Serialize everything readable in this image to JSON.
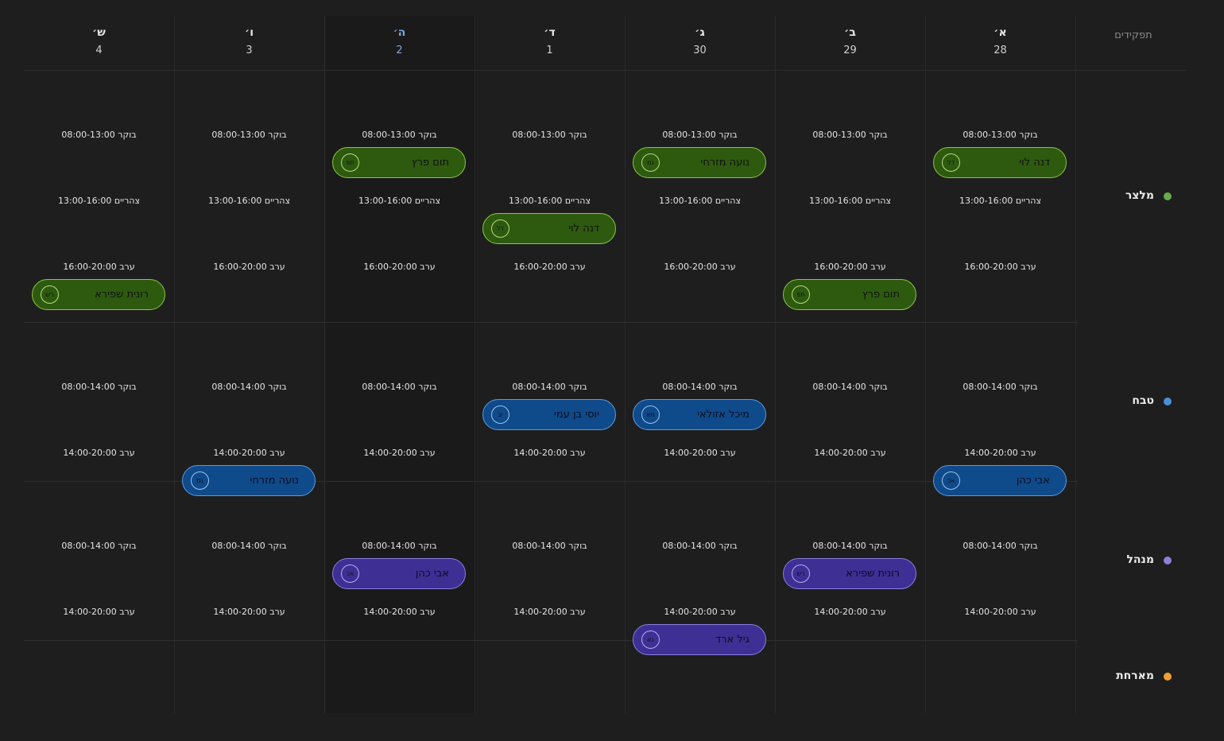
{
  "roles_title": "תפקידים",
  "colors": {
    "מלצר": "#6aa84f",
    "טבח": "#4a90d9",
    "מנהל": "#8a80d6",
    "מארחת": "#f0a030"
  },
  "days": [
    {
      "name": "א׳",
      "date": "28"
    },
    {
      "name": "ב׳",
      "date": "29"
    },
    {
      "name": "ג׳",
      "date": "30"
    },
    {
      "name": "ד׳",
      "date": "1"
    },
    {
      "name": "ה׳",
      "date": "2"
    },
    {
      "name": "ו׳",
      "date": "3"
    },
    {
      "name": "ש׳",
      "date": "4"
    }
  ],
  "roles": [
    {
      "name": "מלצר",
      "shifts": [
        "בוקר 08:00-13:00",
        "צהריים 13:00-16:00",
        "ערב 16:00-20:00"
      ]
    },
    {
      "name": "טבח",
      "shifts": [
        "בוקר 08:00-14:00",
        "ערב 14:00-20:00"
      ]
    },
    {
      "name": "מנהל",
      "shifts": [
        "בוקר 08:00-14:00",
        "ערב 14:00-20:00"
      ]
    },
    {
      "name": "מארחת",
      "shifts": []
    }
  ],
  "assignments": [
    {
      "role": "מלצר",
      "day": "א׳",
      "shift": "בוקר 08:00-13:00",
      "name": "דנה לוי",
      "initials": "דל",
      "color": "green"
    },
    {
      "role": "מלצר",
      "day": "ג׳",
      "shift": "בוקר 08:00-13:00",
      "name": "נועה מזרחי",
      "initials": "נמ",
      "color": "green"
    },
    {
      "role": "מלצר",
      "day": "ה׳",
      "shift": "בוקר 08:00-13:00",
      "name": "תום פרץ",
      "initials": "תפ",
      "color": "green"
    },
    {
      "role": "מלצר",
      "day": "ד׳",
      "shift": "צהריים 13:00-16:00",
      "name": "דנה לוי",
      "initials": "דל",
      "color": "green"
    },
    {
      "role": "מלצר",
      "day": "ב׳",
      "shift": "ערב 16:00-20:00",
      "name": "תום פרץ",
      "initials": "תפ",
      "color": "green"
    },
    {
      "role": "מלצר",
      "day": "ש׳",
      "shift": "ערב 16:00-20:00",
      "name": "רונית שפירא",
      "initials": "רש",
      "color": "green"
    },
    {
      "role": "טבח",
      "day": "ג׳",
      "shift": "בוקר 08:00-14:00",
      "name": "מיכל אזולאי",
      "initials": "מא",
      "color": "blue"
    },
    {
      "role": "טבח",
      "day": "ד׳",
      "shift": "בוקר 08:00-14:00",
      "name": "יוסי בן עמי",
      "initials": "יב",
      "color": "blue"
    },
    {
      "role": "טבח",
      "day": "א׳",
      "shift": "ערב 14:00-20:00",
      "name": "אבי כהן",
      "initials": "אכ",
      "color": "blue"
    },
    {
      "role": "טבח",
      "day": "ו׳",
      "shift": "ערב 14:00-20:00",
      "name": "נועה מזרחי",
      "initials": "נמ",
      "color": "blue"
    },
    {
      "role": "מנהל",
      "day": "ב׳",
      "shift": "בוקר 08:00-14:00",
      "name": "רונית שפירא",
      "initials": "רש",
      "color": "purple"
    },
    {
      "role": "מנהל",
      "day": "ה׳",
      "shift": "בוקר 08:00-14:00",
      "name": "אבי כהן",
      "initials": "אכ",
      "color": "purple"
    },
    {
      "role": "מנהל",
      "day": "ג׳",
      "shift": "ערב 14:00-20:00",
      "name": "גיל ארד",
      "initials": "גא",
      "color": "purple"
    }
  ]
}
